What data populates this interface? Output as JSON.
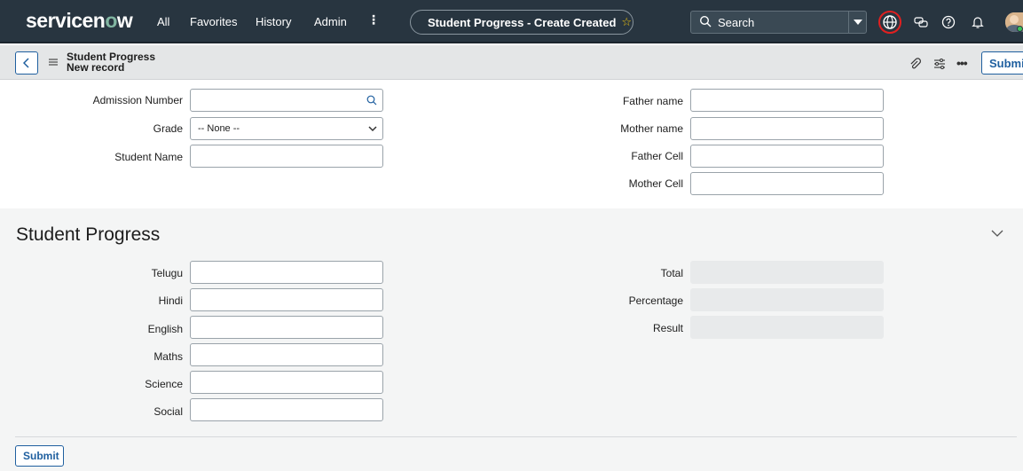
{
  "nav": {
    "logo": "servicenow",
    "links": [
      "All",
      "Favorites",
      "History",
      "Admin"
    ],
    "more": "⋮",
    "tab_title": "Student Progress - Create Created",
    "search_placeholder": "Search"
  },
  "record": {
    "title": "Student Progress",
    "subtitle": "New record",
    "submit_label": "Submit"
  },
  "form": {
    "admission_number": {
      "label": "Admission Number",
      "value": ""
    },
    "grade": {
      "label": "Grade",
      "value": "-- None --"
    },
    "student_name": {
      "label": "Student Name",
      "value": ""
    },
    "father_name": {
      "label": "Father name",
      "value": ""
    },
    "mother_name": {
      "label": "Mother name",
      "value": ""
    },
    "father_cell": {
      "label": "Father Cell",
      "value": ""
    },
    "mother_cell": {
      "label": "Mother Cell",
      "value": ""
    }
  },
  "progress": {
    "section_title": "Student Progress",
    "subjects": [
      {
        "label": "Telugu",
        "value": ""
      },
      {
        "label": "Hindi",
        "value": ""
      },
      {
        "label": "English",
        "value": ""
      },
      {
        "label": "Maths",
        "value": ""
      },
      {
        "label": "Science",
        "value": ""
      },
      {
        "label": "Social",
        "value": ""
      }
    ],
    "results": [
      {
        "label": "Total",
        "value": ""
      },
      {
        "label": "Percentage",
        "value": ""
      },
      {
        "label": "Result",
        "value": ""
      }
    ]
  },
  "footer": {
    "submit_label": "Submit"
  },
  "colors": {
    "nav_bg": "#283540",
    "accent": "#1f5f9f",
    "section_bg": "#f4f5f5",
    "readonly_bg": "#e8eaeb"
  },
  "icons": [
    "search-icon",
    "caret-down-icon",
    "globe-icon",
    "chat-icon",
    "help-icon",
    "bell-icon",
    "avatar",
    "back-icon",
    "hamburger-icon",
    "paperclip-icon",
    "settings-icon",
    "more-icon",
    "chevron-down-icon"
  ]
}
